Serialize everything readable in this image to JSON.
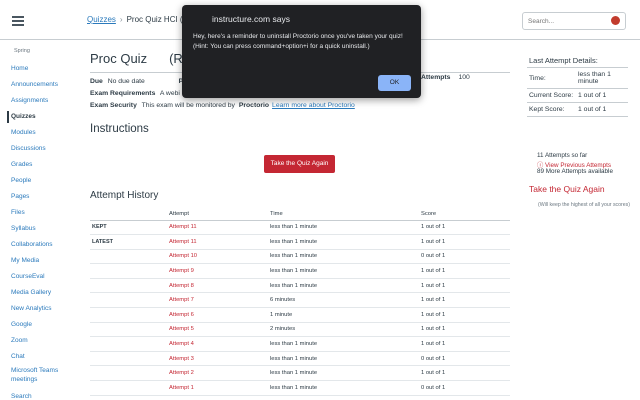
{
  "header": {
    "breadcrumb": [
      {
        "label": "Quizzes"
      },
      {
        "label": "Proc Quiz HCI (Re"
      }
    ],
    "search_placeholder": "Search..."
  },
  "sidebar": {
    "term": "Spring",
    "items": [
      {
        "label": "Home"
      },
      {
        "label": "Announcements"
      },
      {
        "label": "Assignments"
      },
      {
        "label": "Quizzes",
        "active": true
      },
      {
        "label": "Modules"
      },
      {
        "label": "Discussions"
      },
      {
        "label": "Grades"
      },
      {
        "label": "People"
      },
      {
        "label": "Pages"
      },
      {
        "label": "Files"
      },
      {
        "label": "Syllabus"
      },
      {
        "label": "Collaborations"
      },
      {
        "label": "My Media"
      },
      {
        "label": "CourseEval"
      },
      {
        "label": "Media Gallery"
      },
      {
        "label": "New Analytics"
      },
      {
        "label": "Google"
      },
      {
        "label": "Zoom"
      },
      {
        "label": "Chat"
      },
      {
        "label": "Microsoft Teams meetings"
      },
      {
        "label": "Search"
      }
    ]
  },
  "main": {
    "title_part1": "Proc Quiz",
    "title_part2": "(Re",
    "details": {
      "due_label": "Due",
      "due_value": "No due date",
      "points_label": "Po",
      "attempts_label": "Attempts",
      "attempts_value": "100",
      "req_label": "Exam Requirements",
      "req_value": "A webi",
      "security_label": "Exam Security",
      "security_value": "This exam will be monitored by",
      "security_brand": "Proctorio",
      "security_link": "Learn more about Proctorio"
    },
    "instructions_heading": "Instructions",
    "take_again_button": "Take the Quiz Again",
    "history_heading": "Attempt History",
    "history_columns": [
      "",
      "Attempt",
      "Time",
      "Score"
    ],
    "history_rows": [
      {
        "label": "KEPT",
        "attempt": "Attempt 11",
        "time": "less than 1 minute",
        "score": "1 out of 1"
      },
      {
        "label": "LATEST",
        "attempt": "Attempt 11",
        "time": "less than 1 minute",
        "score": "1 out of 1"
      },
      {
        "label": "",
        "attempt": "Attempt 10",
        "time": "less than 1 minute",
        "score": "0 out of 1"
      },
      {
        "label": "",
        "attempt": "Attempt 9",
        "time": "less than 1 minute",
        "score": "1 out of 1"
      },
      {
        "label": "",
        "attempt": "Attempt 8",
        "time": "less than 1 minute",
        "score": "1 out of 1"
      },
      {
        "label": "",
        "attempt": "Attempt 7",
        "time": "6 minutes",
        "score": "1 out of 1"
      },
      {
        "label": "",
        "attempt": "Attempt 6",
        "time": "1 minute",
        "score": "1 out of 1"
      },
      {
        "label": "",
        "attempt": "Attempt 5",
        "time": "2 minutes",
        "score": "1 out of 1"
      },
      {
        "label": "",
        "attempt": "Attempt 4",
        "time": "less than 1 minute",
        "score": "1 out of 1"
      },
      {
        "label": "",
        "attempt": "Attempt 3",
        "time": "less than 1 minute",
        "score": "0 out of 1"
      },
      {
        "label": "",
        "attempt": "Attempt 2",
        "time": "less than 1 minute",
        "score": "1 out of 1"
      },
      {
        "label": "",
        "attempt": "Attempt 1",
        "time": "less than 1 minute",
        "score": "0 out of 1"
      }
    ]
  },
  "right": {
    "last_attempt_title": "Last Attempt Details:",
    "rows": [
      {
        "key": "Time:",
        "value": "less than 1 minute"
      },
      {
        "key": "Current Score:",
        "value": "1 out of 1"
      },
      {
        "key": "Kept Score:",
        "value": "1 out of 1"
      }
    ],
    "attempts_so_far": "11 Attempts so far",
    "view_previous": "View Previous Attempts",
    "more_attempts": "89 More Attempts available",
    "take_again_link": "Take the Quiz Again",
    "keep_note": "(Will keep the highest of all your scores)"
  },
  "dialog": {
    "title": "instructure.com says",
    "message": "Hey, here's a reminder to uninstall Proctorio once you've taken your quiz! (Hint: You can press command+option+i for a quick uninstall.)",
    "ok_label": "OK"
  },
  "colors": {
    "accent_red": "#c42733",
    "link_blue": "#2b7abc",
    "dialog_bg": "#202124",
    "dialog_button": "#8ab4f8"
  }
}
